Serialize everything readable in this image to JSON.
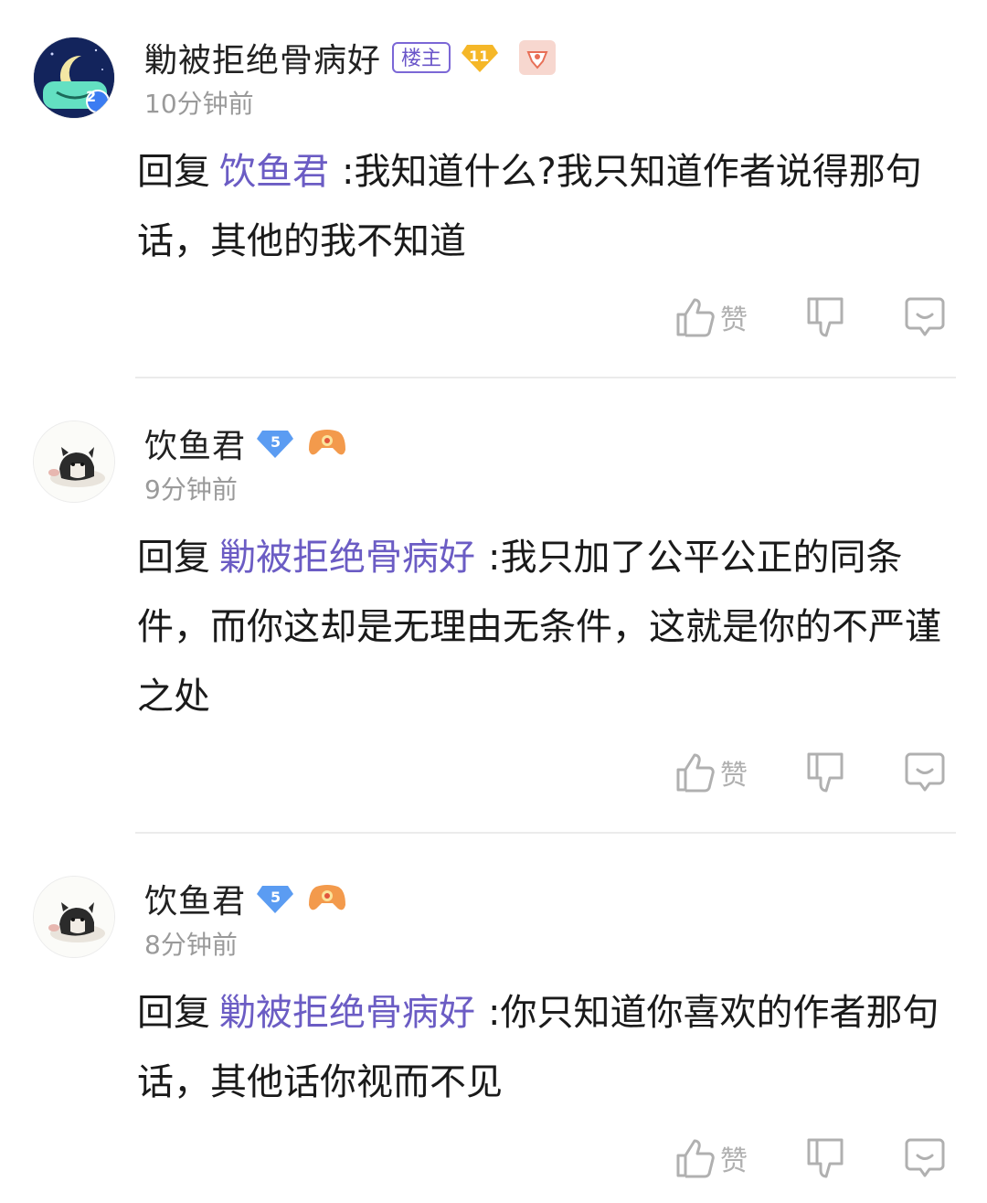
{
  "comments": [
    {
      "username": "勦被拒绝骨病好",
      "host_badge": "楼主",
      "level": "11",
      "time": "10分钟前",
      "reply_prefix": "回复",
      "reply_target": "饮鱼君",
      "text": ":我知道什么?我只知道作者说得那句话，其他的我不知道",
      "avatar_level": "2",
      "like_label": "赞"
    },
    {
      "username": "饮鱼君",
      "level": "5",
      "time": "9分钟前",
      "reply_prefix": "回复",
      "reply_target": "勦被拒绝骨病好",
      "text": ":我只加了公平公正的同条件，而你这却是无理由无条件，这就是你的不严谨之处",
      "like_label": "赞"
    },
    {
      "username": "饮鱼君",
      "level": "5",
      "time": "8分钟前",
      "reply_prefix": "回复",
      "reply_target": "勦被拒绝骨病好",
      "text": ":你只知道你喜欢的作者那句话，其他话你视而不见",
      "like_label": "赞"
    }
  ],
  "colors": {
    "accent_purple": "#6b5cc4",
    "time_gray": "#9a9a9a",
    "icon_gray": "#b0b0b0",
    "level_gold": "#f5b728",
    "level_blue": "#5b9cf2"
  },
  "icons": [
    "thumbs-up-icon",
    "thumbs-down-icon",
    "comment-bubble-icon",
    "moon-avatar",
    "dog-avatar",
    "fan-badge-icon",
    "gamepad-badge-icon"
  ]
}
